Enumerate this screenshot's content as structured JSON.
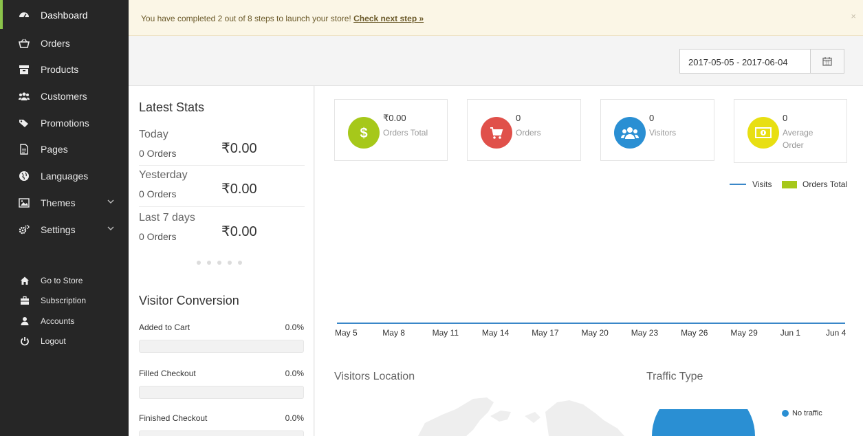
{
  "sidebar": {
    "items": [
      {
        "label": "Dashboard"
      },
      {
        "label": "Orders"
      },
      {
        "label": "Products"
      },
      {
        "label": "Customers"
      },
      {
        "label": "Promotions"
      },
      {
        "label": "Pages"
      },
      {
        "label": "Languages"
      },
      {
        "label": "Themes"
      },
      {
        "label": "Settings"
      }
    ],
    "secondary": [
      {
        "label": "Go to Store"
      },
      {
        "label": "Subscription"
      },
      {
        "label": "Accounts"
      },
      {
        "label": "Logout"
      }
    ]
  },
  "notice": {
    "text": "You have completed 2 out of 8 steps to launch your store!",
    "link": "Check next step »",
    "close": "×"
  },
  "daterange": {
    "value": "2017-05-05 - 2017-06-04"
  },
  "latest_stats": {
    "title": "Latest Stats",
    "rows": [
      {
        "period": "Today",
        "orders": "0 Orders",
        "amount": "₹0.00"
      },
      {
        "period": "Yesterday",
        "orders": "0 Orders",
        "amount": "₹0.00"
      },
      {
        "period": "Last 7 days",
        "orders": "0 Orders",
        "amount": "₹0.00"
      }
    ]
  },
  "visitor_conversion": {
    "title": "Visitor Conversion",
    "rows": [
      {
        "label": "Added to Cart",
        "value": "0.0%"
      },
      {
        "label": "Filled Checkout",
        "value": "0.0%"
      },
      {
        "label": "Finished Checkout",
        "value": "0.0%"
      }
    ]
  },
  "cards": [
    {
      "value": "₹0.00",
      "label": "Orders Total",
      "color": "#a6c81a",
      "icon": "dollar-icon"
    },
    {
      "value": "0",
      "label": "Orders",
      "color": "#e0504a",
      "icon": "cart-icon"
    },
    {
      "value": "0",
      "label": "Visitors",
      "color": "#2a8fd3",
      "icon": "users-icon"
    },
    {
      "value": "0",
      "label": "Average Order",
      "color": "#e8df12",
      "icon": "money-icon"
    }
  ],
  "chart_data": {
    "type": "line",
    "x": [
      "May 5",
      "May 8",
      "May 11",
      "May 14",
      "May 17",
      "May 20",
      "May 23",
      "May 26",
      "May 29",
      "Jun 1",
      "Jun 4"
    ],
    "series": [
      {
        "name": "Visits",
        "values": [
          0,
          0,
          0,
          0,
          0,
          0,
          0,
          0,
          0,
          0,
          0
        ],
        "color": "#3a87c8"
      },
      {
        "name": "Orders Total",
        "values": [
          0,
          0,
          0,
          0,
          0,
          0,
          0,
          0,
          0,
          0,
          0
        ],
        "color": "#a6c81a"
      }
    ],
    "legend": "top-right"
  },
  "visitors_location": {
    "title": "Visitors Location"
  },
  "traffic_type": {
    "title": "Traffic Type",
    "legend": "No traffic",
    "color": "#2a8fd3"
  }
}
